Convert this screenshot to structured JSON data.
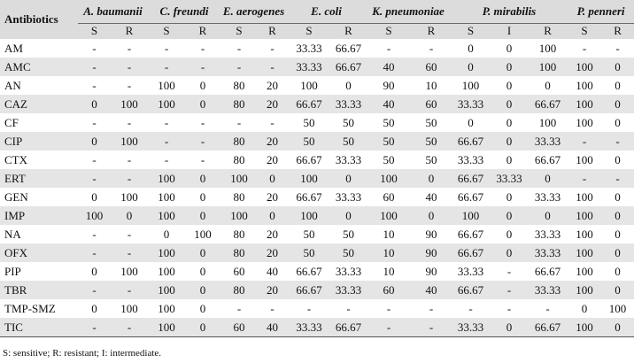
{
  "header_label": "Antibiotics",
  "organisms": [
    {
      "name": "A. baumanii",
      "cols": [
        "S",
        "R"
      ]
    },
    {
      "name": "C. freundi",
      "cols": [
        "S",
        "R"
      ]
    },
    {
      "name": "E. aerogenes",
      "cols": [
        "S",
        "R"
      ]
    },
    {
      "name": "E. coli",
      "cols": [
        "S",
        "R"
      ]
    },
    {
      "name": "K. pneumoniae",
      "cols": [
        "S",
        "R"
      ]
    },
    {
      "name": "P. mirabilis",
      "cols": [
        "S",
        "I",
        "R"
      ]
    },
    {
      "name": "P. penneri",
      "cols": [
        "S",
        "R"
      ]
    }
  ],
  "rows": [
    {
      "name": "AM",
      "values": [
        "-",
        "-",
        "-",
        "-",
        "-",
        "-",
        "33.33",
        "66.67",
        "-",
        "-",
        "0",
        "0",
        "100",
        "-",
        "-"
      ]
    },
    {
      "name": "AMC",
      "values": [
        "-",
        "-",
        "-",
        "-",
        "-",
        "-",
        "33.33",
        "66.67",
        "40",
        "60",
        "0",
        "0",
        "100",
        "100",
        "0"
      ]
    },
    {
      "name": "AN",
      "values": [
        "-",
        "-",
        "100",
        "0",
        "80",
        "20",
        "100",
        "0",
        "90",
        "10",
        "100",
        "0",
        "0",
        "100",
        "0"
      ]
    },
    {
      "name": "CAZ",
      "values": [
        "0",
        "100",
        "100",
        "0",
        "80",
        "20",
        "66.67",
        "33.33",
        "40",
        "60",
        "33.33",
        "0",
        "66.67",
        "100",
        "0"
      ]
    },
    {
      "name": "CF",
      "values": [
        "-",
        "-",
        "-",
        "-",
        "-",
        "-",
        "50",
        "50",
        "50",
        "50",
        "0",
        "0",
        "100",
        "100",
        "0"
      ]
    },
    {
      "name": "CIP",
      "values": [
        "0",
        "100",
        "-",
        "-",
        "80",
        "20",
        "50",
        "50",
        "50",
        "50",
        "66.67",
        "0",
        "33.33",
        "-",
        "-"
      ]
    },
    {
      "name": "CTX",
      "values": [
        "-",
        "-",
        "-",
        "-",
        "80",
        "20",
        "66.67",
        "33.33",
        "50",
        "50",
        "33.33",
        "0",
        "66.67",
        "100",
        "0"
      ]
    },
    {
      "name": "ERT",
      "values": [
        "-",
        "-",
        "100",
        "0",
        "100",
        "0",
        "100",
        "0",
        "100",
        "0",
        "66.67",
        "33.33",
        "0",
        "-",
        "-"
      ]
    },
    {
      "name": "GEN",
      "values": [
        "0",
        "100",
        "100",
        "0",
        "80",
        "20",
        "66.67",
        "33.33",
        "60",
        "40",
        "66.67",
        "0",
        "33.33",
        "100",
        "0"
      ]
    },
    {
      "name": "IMP",
      "values": [
        "100",
        "0",
        "100",
        "0",
        "100",
        "0",
        "100",
        "0",
        "100",
        "0",
        "100",
        "0",
        "0",
        "100",
        "0"
      ]
    },
    {
      "name": "NA",
      "values": [
        "-",
        "-",
        "0",
        "100",
        "80",
        "20",
        "50",
        "50",
        "10",
        "90",
        "66.67",
        "0",
        "33.33",
        "100",
        "0"
      ]
    },
    {
      "name": "OFX",
      "values": [
        "-",
        "-",
        "100",
        "0",
        "80",
        "20",
        "50",
        "50",
        "10",
        "90",
        "66.67",
        "0",
        "33.33",
        "100",
        "0"
      ]
    },
    {
      "name": "PIP",
      "values": [
        "0",
        "100",
        "100",
        "0",
        "60",
        "40",
        "66.67",
        "33.33",
        "10",
        "90",
        "33.33",
        "-",
        "66.67",
        "100",
        "0"
      ]
    },
    {
      "name": "TBR",
      "values": [
        "-",
        "-",
        "100",
        "0",
        "80",
        "20",
        "66.67",
        "33.33",
        "60",
        "40",
        "66.67",
        "-",
        "33.33",
        "100",
        "0"
      ]
    },
    {
      "name": "TMP-SMZ",
      "values": [
        "0",
        "100",
        "100",
        "0",
        "-",
        "-",
        "-",
        "-",
        "-",
        "-",
        "-",
        "-",
        "-",
        "0",
        "100"
      ]
    },
    {
      "name": "TIC",
      "values": [
        "-",
        "-",
        "100",
        "0",
        "60",
        "40",
        "33.33",
        "66.67",
        "-",
        "-",
        "33.33",
        "0",
        "66.67",
        "100",
        "0"
      ]
    }
  ],
  "footnote": "S: sensitive; R: resistant; I: intermediate."
}
